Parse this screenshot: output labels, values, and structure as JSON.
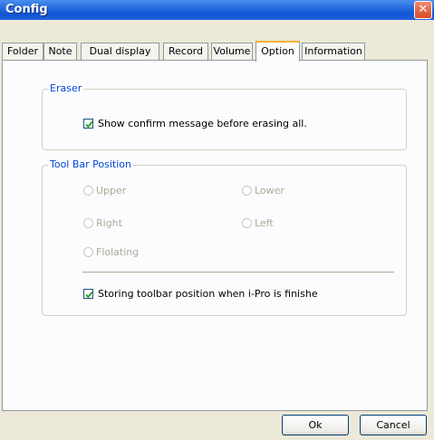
{
  "window": {
    "title": "Config"
  },
  "tabs": [
    {
      "label": "Folder"
    },
    {
      "label": "Note"
    },
    {
      "label": "Dual display"
    },
    {
      "label": "Record"
    },
    {
      "label": "Volume"
    },
    {
      "label": "Option"
    },
    {
      "label": "Information"
    }
  ],
  "active_tab": "Option",
  "eraser": {
    "label": "Eraser",
    "confirm_checkbox": {
      "label": "Show confirm message before erasing all.",
      "checked": true
    }
  },
  "toolbar_position": {
    "label": "Tool Bar Position",
    "options": [
      {
        "label": "Upper",
        "selected": false,
        "enabled": false
      },
      {
        "label": "Lower",
        "selected": false,
        "enabled": false
      },
      {
        "label": "Right",
        "selected": false,
        "enabled": false
      },
      {
        "label": "Left",
        "selected": false,
        "enabled": false
      },
      {
        "label": "Flolating",
        "selected": false,
        "enabled": false
      }
    ],
    "store_checkbox": {
      "label": "Storing toolbar position when i-Pro is finishe",
      "checked": true
    }
  },
  "buttons": {
    "ok": "Ok",
    "cancel": "Cancel"
  }
}
